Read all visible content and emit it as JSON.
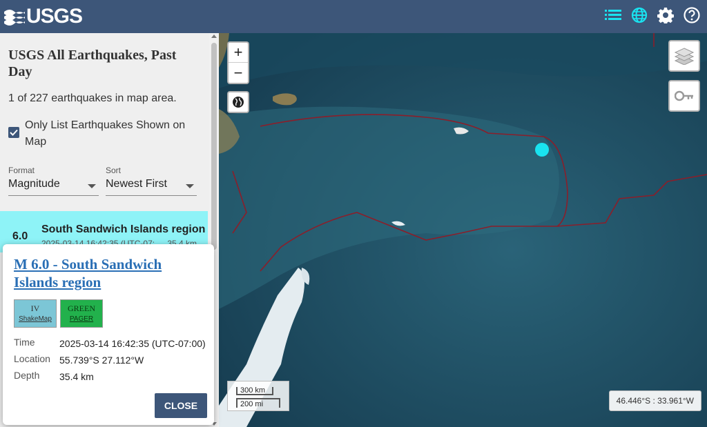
{
  "header": {
    "logo_text": "USGS",
    "icons": [
      "list-icon",
      "globe-icon",
      "gear-icon",
      "help-icon"
    ]
  },
  "sidebar": {
    "feed_title": "USGS All Earthquakes, Past Day",
    "count_text": "1 of 227 earthquakes in map area.",
    "only_list_label": "Only List Earthquakes Shown on Map",
    "only_list_checked": true,
    "format_label": "Format",
    "format_value": "Magnitude",
    "sort_label": "Sort",
    "sort_value": "Newest First",
    "item": {
      "magnitude": "6.0",
      "place": "South Sandwich Islands region",
      "time": "2025-03-14 16:42:35 (UTC-07:",
      "depth": "35.4 km"
    }
  },
  "map": {
    "zoom_in": "+",
    "zoom_out": "−",
    "scale_km": "300 km",
    "scale_mi": "200 mi",
    "coords": "46.446°S : 33.961°W",
    "colors": {
      "ocean": "#1f4f66",
      "plate_boundary": "#8b1e2a",
      "marker": "#19e3f0"
    }
  },
  "popup": {
    "title": "M 6.0 - South Sandwich Islands region",
    "shakemap_top": "IV",
    "shakemap_bottom": "ShakeMap",
    "pager_top": "GREEN",
    "pager_bottom": "PAGER",
    "time_label": "Time",
    "time_value": "2025-03-14 16:42:35 (UTC-07:00)",
    "location_label": "Location",
    "location_value": "55.739°S 27.112°W",
    "depth_label": "Depth",
    "depth_value": "35.4 km",
    "close_label": "CLOSE"
  }
}
